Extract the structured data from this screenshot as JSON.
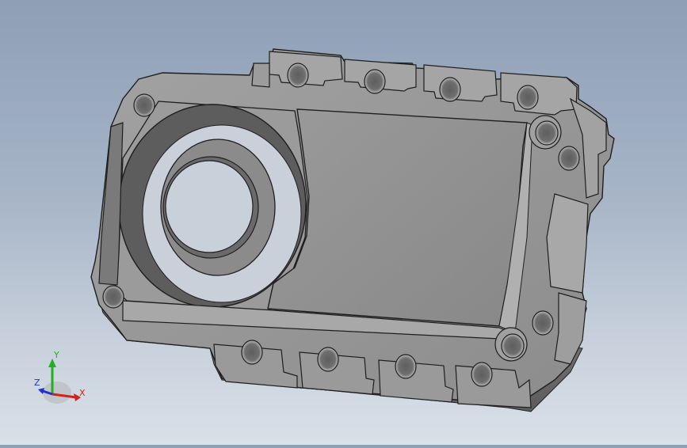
{
  "viewport": {
    "background_top": "#8e9fb6",
    "background_bottom": "#d9e0e8",
    "part_color": "#8f8f8f"
  },
  "triad": {
    "x_label": "X",
    "y_label": "Y",
    "z_label": "Z",
    "x_color": "#d42020",
    "y_color": "#20b020",
    "z_color": "#2030d0"
  }
}
